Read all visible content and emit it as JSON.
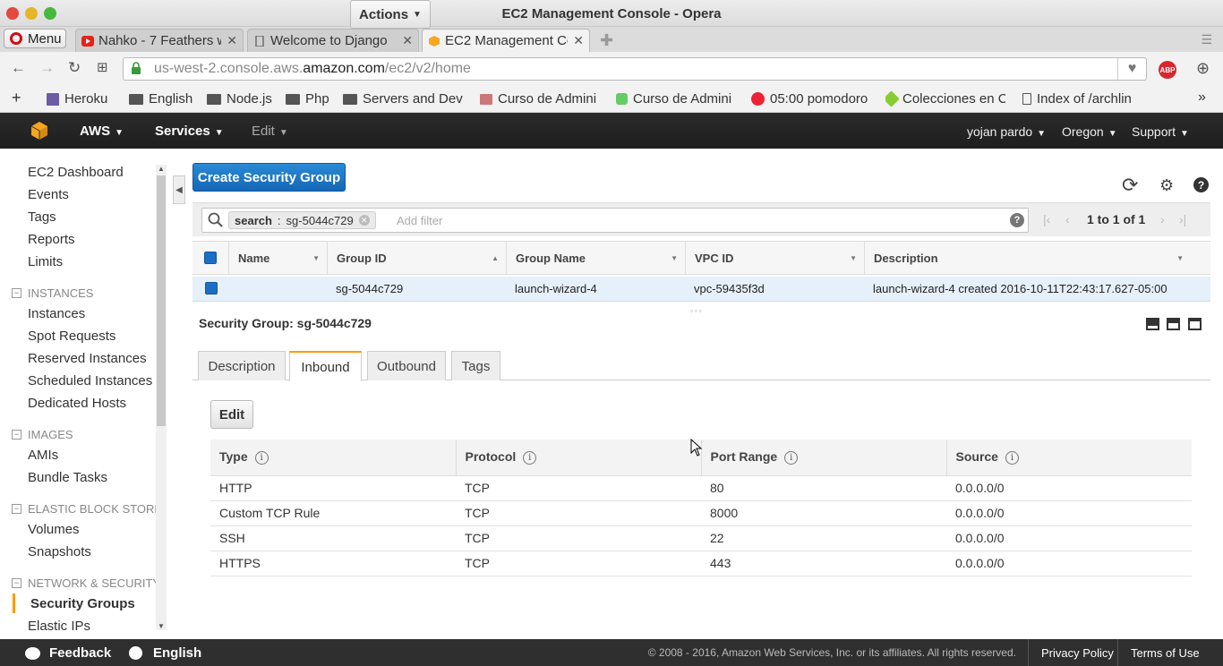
{
  "window": {
    "title": "EC2 Management Console - Opera"
  },
  "browser": {
    "menu_label": "Menu",
    "tabs": [
      {
        "label": "Nahko - 7 Feathers w"
      },
      {
        "label": "Welcome to Django"
      },
      {
        "label": "EC2 Management Co"
      }
    ],
    "url": {
      "prefix": "us-west-2.console.aws.",
      "domain": "amazon.com",
      "path": "/ec2/v2/home"
    },
    "abp_label": "ABP",
    "bookmarks": [
      {
        "label": "Heroku"
      },
      {
        "label": "English"
      },
      {
        "label": "Node.js"
      },
      {
        "label": "Php"
      },
      {
        "label": "Servers and Dev"
      },
      {
        "label": "Curso de Admini"
      },
      {
        "label": "Curso de Admini"
      },
      {
        "label": "05:00 pomodoro"
      },
      {
        "label": "Colecciones en C"
      },
      {
        "label": "Index of /archlin"
      }
    ]
  },
  "aws_nav": {
    "aws": "AWS",
    "services": "Services",
    "edit": "Edit",
    "user": "yojan pardo",
    "region": "Oregon",
    "support": "Support"
  },
  "sidebar": {
    "top_items": [
      "EC2 Dashboard",
      "Events",
      "Tags",
      "Reports",
      "Limits"
    ],
    "sections": [
      {
        "title": "INSTANCES",
        "items": [
          "Instances",
          "Spot Requests",
          "Reserved Instances",
          "Scheduled Instances",
          "Dedicated Hosts"
        ]
      },
      {
        "title": "IMAGES",
        "items": [
          "AMIs",
          "Bundle Tasks"
        ]
      },
      {
        "title": "ELASTIC BLOCK STORE",
        "items": [
          "Volumes",
          "Snapshots"
        ]
      },
      {
        "title": "NETWORK & SECURITY",
        "items": [
          "Security Groups",
          "Elastic IPs"
        ]
      }
    ],
    "active": "Security Groups"
  },
  "toolbar": {
    "create_label": "Create Security Group",
    "actions_label": "Actions"
  },
  "filter": {
    "chip_key": "search",
    "chip_sep": ":",
    "chip_value": "sg-5044c729",
    "placeholder": "Add filter",
    "pager_text": "1 to 1 of 1"
  },
  "grid": {
    "columns": [
      "Name",
      "Group ID",
      "Group Name",
      "VPC ID",
      "Description"
    ],
    "rows": [
      {
        "name": "",
        "group_id": "sg-5044c729",
        "group_name": "launch-wizard-4",
        "vpc_id": "vpc-59435f3d",
        "description": "launch-wizard-4 created 2016-10-11T22:43:17.627-05:00"
      }
    ]
  },
  "details": {
    "title": "Security Group: sg-5044c729",
    "tabs": [
      "Description",
      "Inbound",
      "Outbound",
      "Tags"
    ],
    "active_tab": "Inbound",
    "edit_label": "Edit",
    "rules_columns": [
      "Type",
      "Protocol",
      "Port Range",
      "Source"
    ],
    "rules": [
      {
        "type": "HTTP",
        "protocol": "TCP",
        "port": "80",
        "source": "0.0.0.0/0"
      },
      {
        "type": "Custom TCP Rule",
        "protocol": "TCP",
        "port": "8000",
        "source": "0.0.0.0/0"
      },
      {
        "type": "SSH",
        "protocol": "TCP",
        "port": "22",
        "source": "0.0.0.0/0"
      },
      {
        "type": "HTTPS",
        "protocol": "TCP",
        "port": "443",
        "source": "0.0.0.0/0"
      }
    ]
  },
  "footer": {
    "feedback": "Feedback",
    "language": "English",
    "copyright": "© 2008 - 2016, Amazon Web Services, Inc. or its affiliates. All rights reserved.",
    "privacy": "Privacy Policy",
    "terms": "Terms of Use"
  },
  "colors": {
    "primary_button": "#1567b5",
    "active_accent": "#ff9900",
    "aws_bar": "#232f3e",
    "selected_row": "#e6f0fa"
  }
}
